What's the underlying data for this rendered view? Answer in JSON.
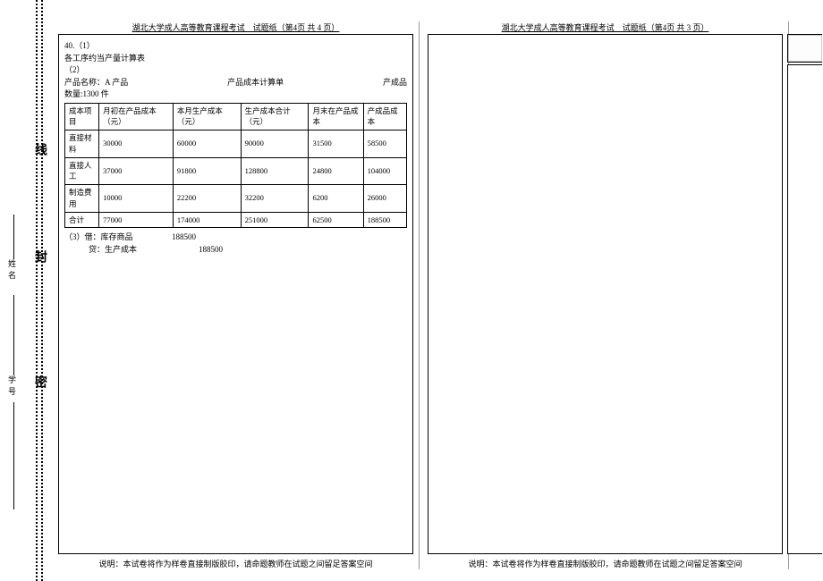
{
  "gutter": {
    "xian": "线",
    "feng": "封",
    "mi": "密",
    "xingming": "姓名",
    "xuehao": "学号"
  },
  "left_page": {
    "header": "湖北大学成人高等教育课程考试　试题纸（第4页 共 4 页）",
    "footer": "说明：本试卷将作为样卷直接制版胶印，请命题教师在试题之间留足答案空间",
    "q_no": "40.（1）",
    "q_line1": "各工序约当产量计算表",
    "q_sub2": "（2）",
    "prod_name_label": "产品名称：",
    "prod_name_value": "A 产品",
    "sheet_title": "产品成本计算单",
    "prod_kind": "产成品",
    "qty": "数量:1300 件",
    "table": {
      "headers": [
        "成本项目",
        "月初在产品成本（元）",
        "本月生产成本（元）",
        "生产成本合计（元）",
        "月末在产品成本",
        "产成品成本"
      ],
      "rows": [
        [
          "直接材料",
          "30000",
          "60000",
          "90000",
          "31500",
          "58500"
        ],
        [
          "直接人工",
          "37000",
          "91800",
          "128800",
          "24800",
          "104000"
        ],
        [
          "制造费用",
          "10000",
          "22200",
          "32200",
          "6200",
          "26000"
        ],
        [
          "合计",
          "77000",
          "174000",
          "251000",
          "62500",
          "188500"
        ]
      ]
    },
    "entry_no": "（3）借：库存商品",
    "entry_amt1": "188500",
    "entry_cr": "　　　贷：生产成本",
    "entry_amt2": "188500"
  },
  "right_page": {
    "header": "湖北大学成人高等教育课程考试　试题纸（第4页 共 3 页）",
    "footer": "说明：本试卷将作为样卷直接制版胶印，请命题教师在试题之间留足答案空间"
  }
}
